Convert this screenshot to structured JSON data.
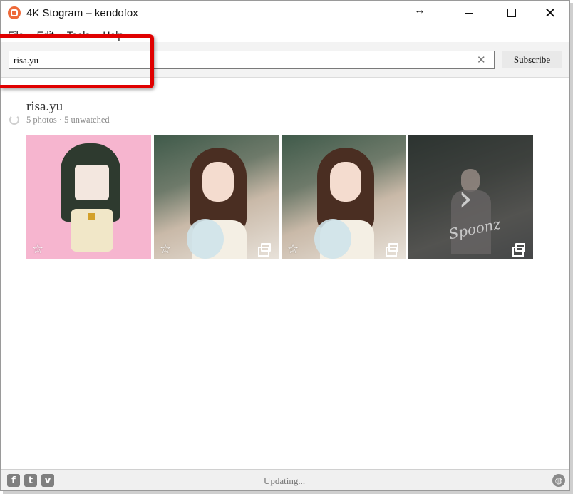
{
  "window": {
    "title": "4K Stogram – kendofox",
    "app_icon": "app-logo-icon",
    "controls": {
      "resize_glyph": "↔",
      "minimize": "minimize-icon",
      "maximize": "maximize-icon",
      "close": "✕"
    }
  },
  "menubar": {
    "items": [
      "File",
      "Edit",
      "Tools",
      "Help"
    ]
  },
  "search": {
    "value": "risa.yu",
    "clear_glyph": "✕",
    "subscribe_label": "Subscribe"
  },
  "account": {
    "name": "risa.yu",
    "stats": "5 photos · 5 unwatched",
    "thumbnails": [
      {
        "kind": "pixel-art",
        "badge": "☆",
        "multi": false
      },
      {
        "kind": "photo",
        "badge": "☆",
        "multi": true
      },
      {
        "kind": "photo",
        "badge": "☆",
        "multi": true
      },
      {
        "kind": "photo-dimmed",
        "text": "Spoonz",
        "chevron": "›",
        "multi": true
      }
    ]
  },
  "statusbar": {
    "status_text": "Updating...",
    "social": {
      "facebook": "f",
      "twitter": "t",
      "vimeo": "v"
    },
    "globe": "◍"
  },
  "colors": {
    "highlight": "#e00000",
    "accent": "#ee6a3a",
    "pink_bg": "#f6b5cf"
  }
}
